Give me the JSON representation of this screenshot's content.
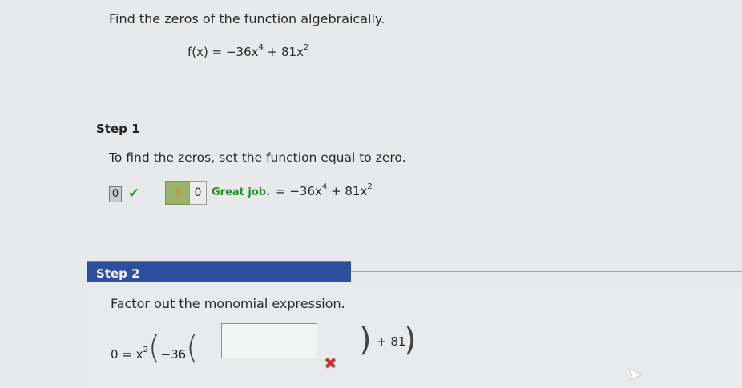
{
  "question": {
    "prompt": "Find the zeros of the function algebraically.",
    "function_lhs": "f(x) = −36x",
    "exp1": "4",
    "function_mid": " + 81x",
    "exp2": "2"
  },
  "step1": {
    "label": "Step 1",
    "text": "To find the zeros, set the function equal to zero.",
    "left_value": "0",
    "answer_value": "0",
    "feedback": "Great job.",
    "eq_lhs": "= −36x",
    "exp1": "4",
    "eq_mid": " + 81x",
    "exp2": "2"
  },
  "step2": {
    "label": "Step 2",
    "text": "Factor out the monomial expression.",
    "lhs": "0 = x",
    "exp": "2",
    "coef": "−36",
    "rhs": "+ 81",
    "input_value": ""
  },
  "colors": {
    "step_bar": "#2d4f9e",
    "correct": "#2e8b2e",
    "incorrect": "#d03030"
  },
  "icons": [
    "check-icon",
    "key-icon",
    "x-mark-icon",
    "cursor-icon"
  ]
}
